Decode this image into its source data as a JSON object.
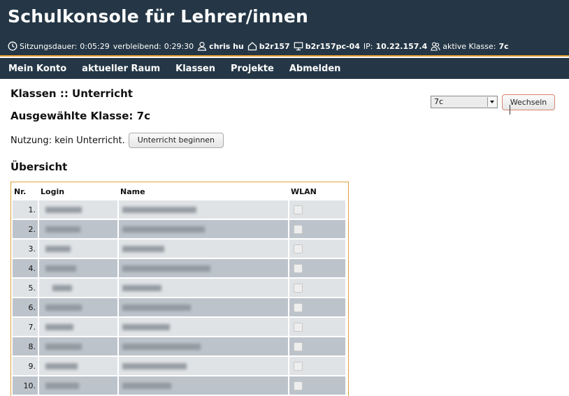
{
  "header": {
    "title": "Schulkonsole für Lehrer/innen",
    "session_label": "Sitzungsdauer:",
    "session_value": "0:05:29",
    "remaining_label": "verbleibend:",
    "remaining_value": "0:29:30",
    "user": "chris hu",
    "room": "b2r157",
    "workstation": "b2r157pc-04",
    "ip_label": "IP:",
    "ip_value": "10.22.157.4",
    "class_label": "aktive Klasse:",
    "class_value": "7c",
    "icons": [
      "clock-icon",
      "user-icon",
      "house-icon",
      "monitor-icon",
      "group-icon"
    ]
  },
  "nav": {
    "items": [
      "Mein Konto",
      "aktueller Raum",
      "Klassen",
      "Projekte",
      "Abmelden"
    ]
  },
  "content": {
    "section_title": "Klassen :: Unterricht",
    "selected_class": "Ausgewählte Klasse: 7c",
    "usage_text": "Nutzung: kein Unterricht.",
    "start_button": "Unterricht beginnen",
    "overview_title": "Übersicht",
    "class_select_value": "7c",
    "switch_button": "Wechseln"
  },
  "table": {
    "columns": [
      "Nr.",
      "Login",
      "Name",
      "WLAN"
    ],
    "rows": [
      {
        "nr": "1."
      },
      {
        "nr": "2."
      },
      {
        "nr": "3."
      },
      {
        "nr": "4."
      },
      {
        "nr": "5."
      },
      {
        "nr": "6."
      },
      {
        "nr": "7."
      },
      {
        "nr": "8."
      },
      {
        "nr": "9."
      },
      {
        "nr": "10."
      }
    ]
  },
  "colors": {
    "header_bg": "#253746",
    "accent": "#e39a2c",
    "row_light": "#e0e3e6",
    "row_dark": "#bcc3cb"
  }
}
